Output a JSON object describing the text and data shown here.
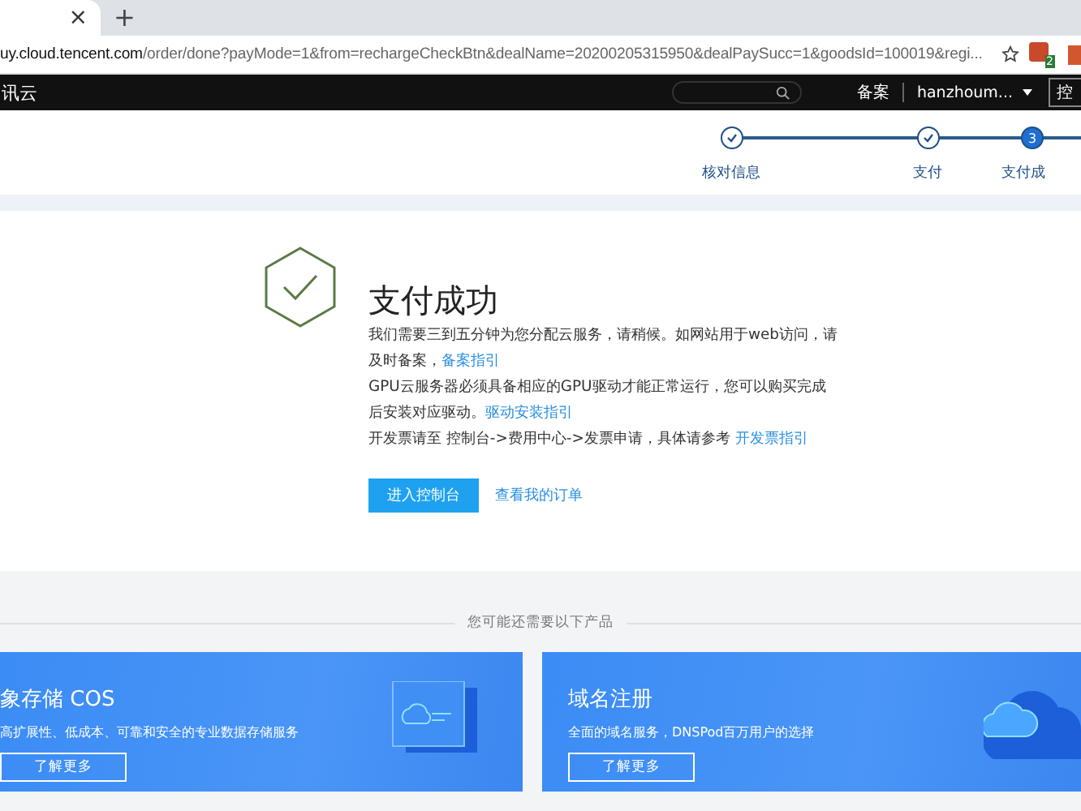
{
  "browser": {
    "tab_close": "×",
    "new_tab": "+",
    "url_host": "uy.cloud.tencent.com",
    "url_path": "/order/done?payMode=1&from=rechargeCheckBtn&dealName=20200205315950&dealPaySucc=1&goodsId=100019&regi...",
    "extension_badge": "2"
  },
  "topnav": {
    "brand": "讯云",
    "links": [
      "备案"
    ],
    "user": "hanzhoum...",
    "button": "控"
  },
  "steps": [
    {
      "label": "核对信息",
      "completed": true,
      "selected": false
    },
    {
      "label": "支付",
      "completed": true,
      "selected": false
    },
    {
      "label": "支付成",
      "completed": false,
      "selected": true,
      "number": "3"
    }
  ],
  "result": {
    "title": "支付成功",
    "paragraphs": [
      {
        "text": "我们需要三到五分钟为您分配云服务，请稍候。如网站用于web访问，请及时备案，",
        "link": "备案指引"
      },
      {
        "text": "GPU云服务器必须具备相应的GPU驱动才能正常运行，您可以购买完成后安装对应驱动。",
        "link": "驱动安装指引"
      },
      {
        "text": "开发票请至 控制台->费用中心->发票申请，具体请参考 ",
        "link": "开发票指引"
      }
    ],
    "primary_button": "进入控制台",
    "secondary_link": "查看我的订单"
  },
  "recommend": {
    "heading": "您可能还需要以下产品",
    "cards": [
      {
        "title": "象存储 COS",
        "description": "高扩展性、低成本、可靠和安全的专业数据存储服务",
        "button": "了解更多",
        "kind": "window"
      },
      {
        "title": "域名注册",
        "description": "全面的域名服务，DNSPod百万用户的选择",
        "button": "了解更多",
        "kind": "cloud"
      }
    ]
  }
}
